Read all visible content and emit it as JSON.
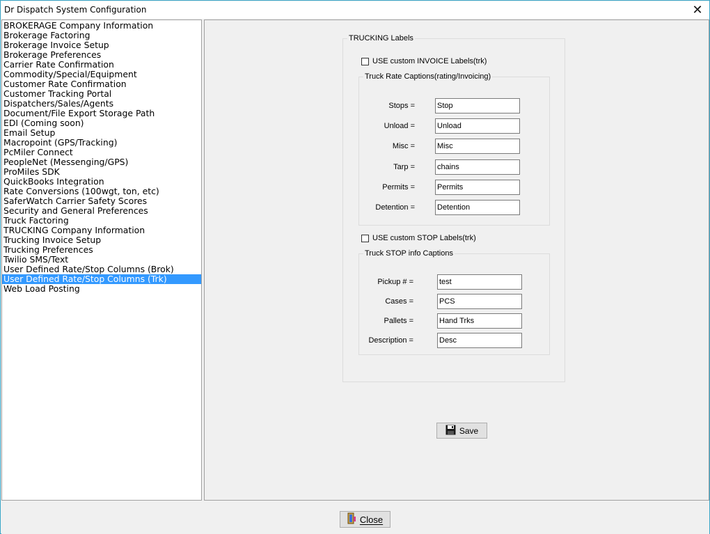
{
  "window": {
    "title": "Dr Dispatch  System Configuration",
    "close_glyph": "✕"
  },
  "nav": {
    "items": [
      "BROKERAGE Company Information",
      "Brokerage Factoring",
      "Brokerage Invoice Setup",
      "Brokerage Preferences",
      "Carrier Rate Confirmation",
      "Commodity/Special/Equipment",
      "Customer Rate Confirmation",
      "Customer Tracking Portal",
      "Dispatchers/Sales/Agents",
      "Document/File Export Storage Path",
      "EDI (Coming soon)",
      "Email Setup",
      "Macropoint (GPS/Tracking)",
      "PcMiler Connect",
      "PeopleNet (Messenging/GPS)",
      "ProMiles SDK",
      "QuickBooks Integration",
      "Rate Conversions (100wgt, ton, etc)",
      "SaferWatch Carrier Safety Scores",
      "Security and General Preferences",
      "Truck Factoring",
      "TRUCKING Company Information",
      "Trucking Invoice Setup",
      "Trucking Preferences",
      "Twilio SMS/Text",
      "User Defined Rate/Stop Columns (Brok)",
      "User Defined Rate/Stop Columns (Trk)",
      "Web Load Posting"
    ],
    "selected_index": 26
  },
  "trucking": {
    "legend": "TRUCKING Labels",
    "invoice_checkbox": {
      "label": "USE custom INVOICE Labels(trk)",
      "checked": false
    },
    "rate_group": {
      "legend": "Truck Rate Captions(rating/Invoicing)",
      "fields": [
        {
          "label": "Stops =",
          "value": "Stop"
        },
        {
          "label": "Unload =",
          "value": "Unload"
        },
        {
          "label": "Misc =",
          "value": "Misc"
        },
        {
          "label": "Tarp =",
          "value": "chains"
        },
        {
          "label": "Permits =",
          "value": "Permits"
        },
        {
          "label": "Detention =",
          "value": "Detention"
        }
      ]
    },
    "stop_checkbox": {
      "label": "USE custom STOP Labels(trk)",
      "checked": false
    },
    "stop_group": {
      "legend": "Truck STOP info Captions",
      "fields": [
        {
          "label": "Pickup # =",
          "value": "test"
        },
        {
          "label": "Cases =",
          "value": "PCS"
        },
        {
          "label": "Pallets =",
          "value": "Hand Trks"
        },
        {
          "label": "Description =",
          "value": "Desc"
        }
      ]
    }
  },
  "buttons": {
    "save": {
      "label": "Save",
      "icon": "floppy-disk-icon"
    },
    "close": {
      "label": "Close",
      "icon": "door-exit-icon"
    }
  },
  "colors": {
    "selection": "#3399ff",
    "window_border": "#3aa6c8",
    "background": "#f0f0f0"
  }
}
